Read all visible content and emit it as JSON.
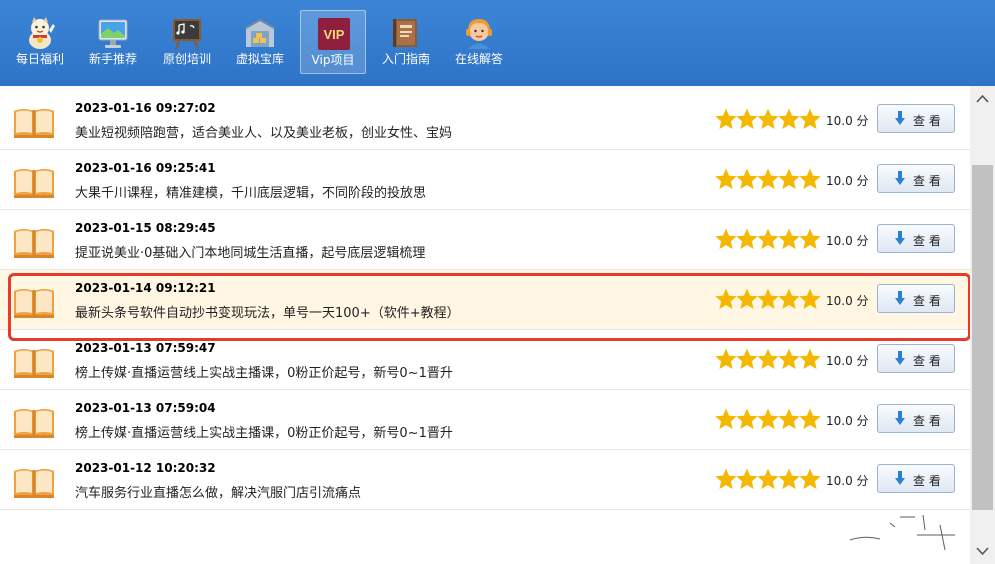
{
  "toolbar": {
    "items": [
      {
        "label": "每日福利",
        "icon": "lucky-cat-icon"
      },
      {
        "label": "新手推荐",
        "icon": "monitor-icon"
      },
      {
        "label": "原创培训",
        "icon": "chalkboard-icon"
      },
      {
        "label": "虚拟宝库",
        "icon": "warehouse-icon"
      },
      {
        "label": "Vip项目",
        "icon": "vip-icon",
        "badge": "VIP",
        "active": true
      },
      {
        "label": "入门指南",
        "icon": "guide-book-icon"
      },
      {
        "label": "在线解答",
        "icon": "support-agent-icon"
      }
    ]
  },
  "list": {
    "rows": [
      {
        "date": "2023-01-16 09:27:02",
        "title": "美业短视频陪跑营，适合美业人、以及美业老板，创业女性、宝妈",
        "score": "10.0 分",
        "button": "查 看",
        "rating": 5
      },
      {
        "date": "2023-01-16 09:25:41",
        "title": "大果千川课程，精准建模，千川底层逻辑，不同阶段的投放思",
        "score": "10.0 分",
        "button": "查 看",
        "rating": 5
      },
      {
        "date": "2023-01-15 08:29:45",
        "title": "提亚说美业·0基础入门本地同城生活直播，起号底层逻辑梳理",
        "score": "10.0 分",
        "button": "查 看",
        "rating": 5
      },
      {
        "date": "2023-01-14 09:12:21",
        "title": "最新头条号软件自动抄书变现玩法，单号一天100+（软件+教程）",
        "score": "10.0 分",
        "button": "查 看",
        "rating": 5,
        "highlighted": true
      },
      {
        "date": "2023-01-13 07:59:47",
        "title": "榜上传媒·直播运营线上实战主播课，0粉正价起号，新号0~1晋升",
        "score": "10.0 分",
        "button": "查 看",
        "rating": 5
      },
      {
        "date": "2023-01-13 07:59:04",
        "title": "榜上传媒·直播运营线上实战主播课，0粉正价起号，新号0~1晋升",
        "score": "10.0 分",
        "button": "查 看",
        "rating": 5
      },
      {
        "date": "2023-01-12 10:20:32",
        "title": "汽车服务行业直播怎么做，解决汽服门店引流痛点",
        "score": "10.0 分",
        "button": "查 看",
        "rating": 5
      }
    ]
  },
  "colors": {
    "toolbar": "#3c85d6",
    "star": "#f5b800",
    "highlight": "#fff7e3",
    "selection": "#e53b2a"
  }
}
